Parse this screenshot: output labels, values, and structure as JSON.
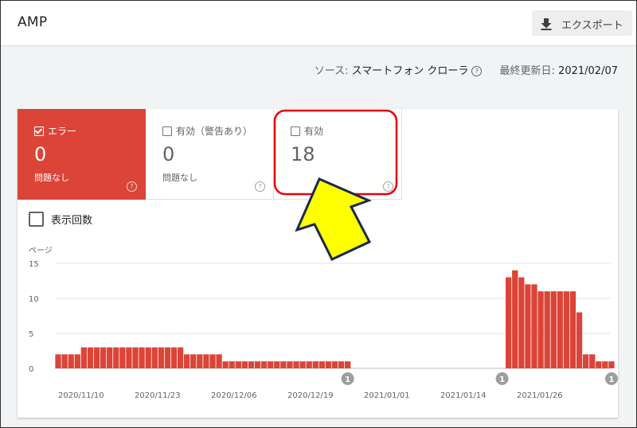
{
  "header": {
    "title": "AMP",
    "export_label": "エクスポート"
  },
  "meta": {
    "source_label": "ソース:",
    "source_value": "スマートフォン クローラ",
    "updated_label": "最終更新日:",
    "updated_value": "2021/02/07"
  },
  "tiles": [
    {
      "label": "エラー",
      "count": "0",
      "sub": "問題なし",
      "selected": true
    },
    {
      "label": "有効（警告あり）",
      "count": "0",
      "sub": "問題なし",
      "selected": false
    },
    {
      "label": "有効",
      "count": "18",
      "sub": "",
      "selected": false
    }
  ],
  "impressions_label": "表示回数",
  "help_glyph": "?",
  "colors": {
    "error": "#db4437",
    "grid": "#e0e0e0",
    "highlight": "#e8000b",
    "arrow": "#ffff00"
  },
  "chart_data": {
    "type": "bar",
    "ylabel": "ページ",
    "ylim": [
      0,
      15
    ],
    "yticks": [
      0,
      5,
      10,
      15
    ],
    "x_tick_labels": [
      "2020/11/10",
      "2020/11/23",
      "2020/12/06",
      "2020/12/19",
      "2021/01/01",
      "2021/01/14",
      "2021/01/26"
    ],
    "values": [
      2,
      2,
      2,
      2,
      3,
      3,
      3,
      3,
      3,
      3,
      3,
      3,
      3,
      3,
      3,
      3,
      3,
      3,
      3,
      3,
      2,
      2,
      2,
      2,
      2,
      2,
      1,
      1,
      1,
      1,
      1,
      1,
      1,
      1,
      1,
      1,
      1,
      1,
      1,
      1,
      1,
      1,
      1,
      1,
      1,
      1,
      0,
      0,
      0,
      0,
      0,
      0,
      0,
      0,
      0,
      0,
      0,
      0,
      0,
      0,
      0,
      0,
      0,
      0,
      0,
      0,
      0,
      0,
      0,
      0,
      13,
      14,
      13,
      12,
      12,
      11,
      11,
      11,
      11,
      11,
      11,
      8,
      2,
      2,
      1,
      1,
      1
    ],
    "annotations": [
      {
        "index": 45,
        "label": "1"
      },
      {
        "index": 69,
        "label": "1"
      },
      {
        "index": 86,
        "label": "1"
      }
    ]
  }
}
